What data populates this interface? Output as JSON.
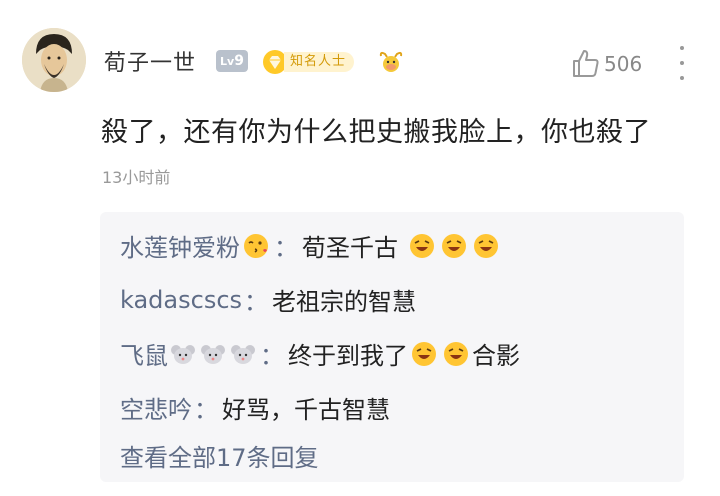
{
  "comment": {
    "author": "荀子一世",
    "level": {
      "prefix": "Lv",
      "number": "9"
    },
    "title_badge": "知名人士",
    "like_count": "506",
    "text": "殺了，还有你为什么把史搬我脸上，你也殺了",
    "time": "13小时前"
  },
  "replies": [
    {
      "author": "水莲钟爱粉",
      "sep": "：",
      "text": "荀圣千古"
    },
    {
      "author": "kadascscs",
      "sep": "：",
      "text": "老祖宗的智慧"
    },
    {
      "author": "飞鼠",
      "sep": "：",
      "text": "终于到我了",
      "text2": "合影"
    },
    {
      "author": "空悲吟",
      "sep": "：",
      "text": "好骂，千古智慧"
    }
  ],
  "view_all_label": "查看全部17条回复",
  "colors": {
    "name_link": "#5f6c86",
    "badge_gold": "#d39a08",
    "reply_bg": "#f6f6f8"
  },
  "icons": [
    "avatar-portrait",
    "gem-icon",
    "ox-zodiac-icon",
    "thumbs-up-icon",
    "more-vertical-icon",
    "kiss-emoji",
    "laugh-emoji",
    "mouse-icon"
  ]
}
